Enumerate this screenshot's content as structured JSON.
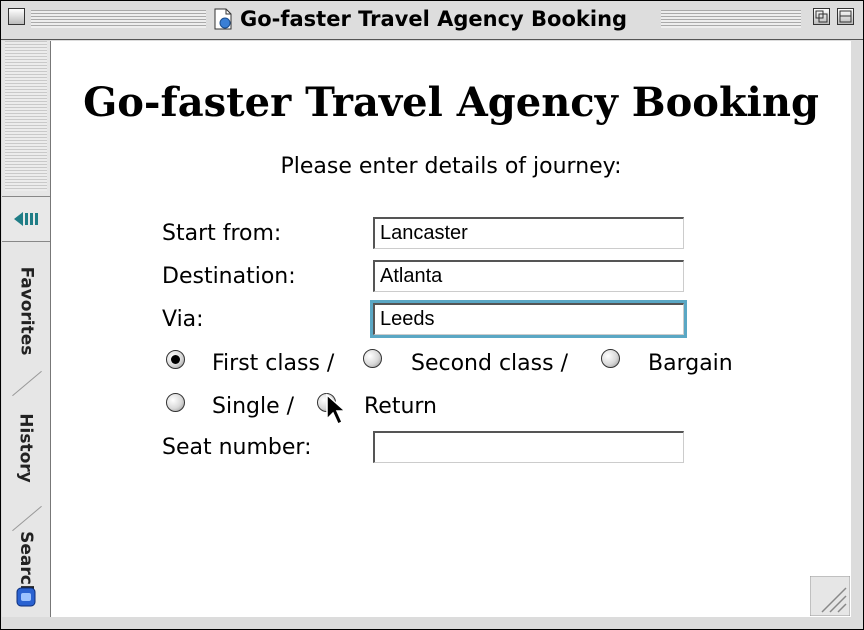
{
  "window": {
    "title": "Go-faster Travel Agency Booking"
  },
  "sidebar": {
    "tabs": [
      {
        "label": "Favorites"
      },
      {
        "label": "History"
      },
      {
        "label": "Search"
      }
    ]
  },
  "form": {
    "heading": "Go-faster Travel Agency Booking",
    "instructions": "Please enter details of journey:",
    "start_label": "Start from:",
    "start_value": "Lancaster",
    "destination_label": "Destination:",
    "destination_value": "Atlanta",
    "via_label": "Via:",
    "via_value": "Leeds",
    "class_options": [
      "First class /",
      "Second class /",
      "Bargain"
    ],
    "class_selected": "First class",
    "journey_options": [
      "Single /",
      "Return"
    ],
    "journey_selected": "",
    "seat_label": "Seat number:",
    "seat_value": ""
  }
}
